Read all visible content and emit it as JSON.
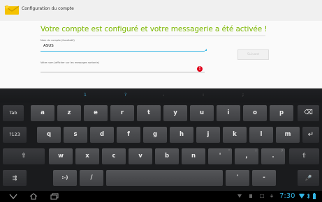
{
  "window": {
    "title": "Configuration du compte"
  },
  "setup": {
    "headline": "Votre compte est configuré et votre messagerie a été activée !",
    "account_name_label": "Nom du compte (facultatif)",
    "account_name_value": "ASUS",
    "your_name_label": "Votre nom (afficher sur les messages sortants)",
    "your_name_value": "",
    "error_icon": "!",
    "next_button": "Suivant"
  },
  "keyboard": {
    "hints": [
      "1",
      "?",
      "-",
      ":",
      ";"
    ],
    "row1": [
      "Tab",
      "a",
      "z",
      "e",
      "r",
      "t",
      "y",
      "u",
      "i",
      "o",
      "p",
      "⌫"
    ],
    "row2": [
      "?123",
      "q",
      "s",
      "d",
      "f",
      "g",
      "h",
      "j",
      "k",
      "l",
      "m",
      "↵"
    ],
    "row3": [
      "⇧",
      "w",
      "x",
      "c",
      "v",
      "b",
      "n",
      "'",
      ",",
      ".",
      "⇧"
    ],
    "row3_sub": [
      "\"",
      "!",
      "?"
    ],
    "row4": [
      "⇶",
      ":-)",
      "/",
      "",
      "'",
      "-",
      "🎤"
    ]
  },
  "status": {
    "clock": "7:30",
    "accent": "#33b5e5",
    "headline_color": "#7cb800",
    "error_color": "#e1001a"
  },
  "navbar": {
    "icons": [
      "back-icon",
      "home-icon",
      "recent-apps-icon"
    ]
  }
}
